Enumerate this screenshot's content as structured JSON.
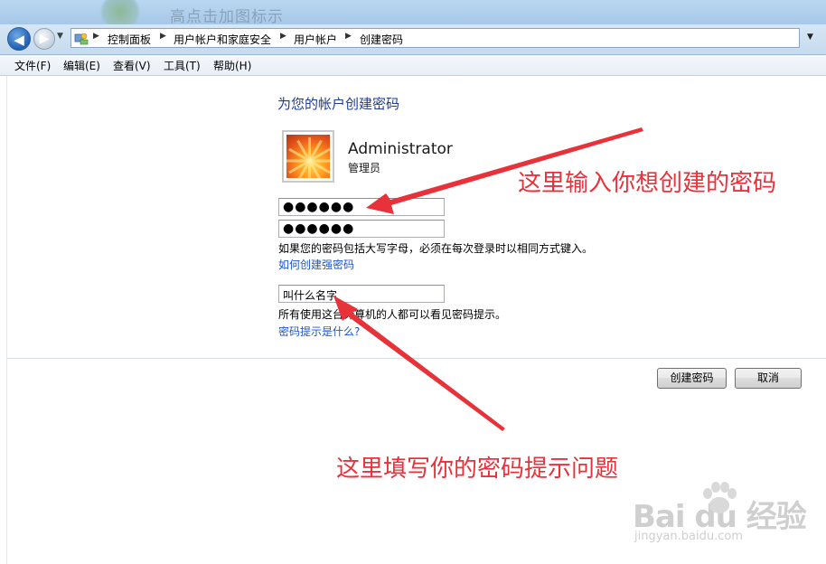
{
  "window": {
    "title": "高点击加图标示"
  },
  "breadcrumb": [
    "控制面板",
    "用户帐户和家庭安全",
    "用户帐户",
    "创建密码"
  ],
  "menu": [
    "文件(F)",
    "编辑(E)",
    "查看(V)",
    "工具(T)",
    "帮助(H)"
  ],
  "page": {
    "heading": "为您的帐户创建密码",
    "user": {
      "name": "Administrator",
      "role": "管理员"
    },
    "new_password": "●●●●●●",
    "confirm_password": "●●●●●●",
    "caps_note": "如果您的密码包括大写字母，必须在每次登录时以相同方式键入。",
    "strong_pwd_link": "如何创建强密码",
    "hint_value": "叫什么名字",
    "hint_note": "所有使用这台计算机的人都可以看见密码提示。",
    "hint_link": "密码提示是什么?"
  },
  "buttons": {
    "create": "创建密码",
    "cancel": "取消"
  },
  "annotations": {
    "password_tip": "这里输入你想创建的密码",
    "hint_tip": "这里填写你的密码提示问题",
    "color": "#e8323a"
  },
  "watermark": {
    "main": "Bai du 经验",
    "sub": "jingyan.baidu.com"
  },
  "icons": [
    "back-arrow",
    "forward-arrow",
    "history-dropdown",
    "control-panel",
    "breadcrumb-separator",
    "address-dropdown"
  ]
}
